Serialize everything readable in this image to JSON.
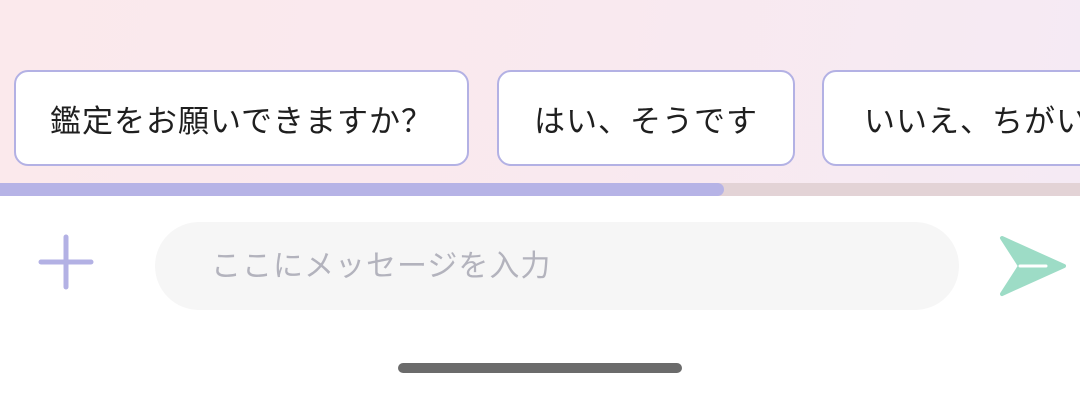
{
  "quick_replies": [
    {
      "label": "鑑定をお願いできますか？"
    },
    {
      "label": "はい、そうです"
    },
    {
      "label": "いいえ、ちがいます"
    }
  ],
  "quick_replies_scroll": {
    "visible_fraction": 0.67
  },
  "composer": {
    "placeholder": "ここにメッセージを入力",
    "value": "",
    "add_icon": "plus-icon",
    "send_icon": "send-arrow-icon"
  },
  "colors": {
    "accent": "#b3b1e4",
    "send": "#9ddcc6",
    "chat_background": "#fbe9ec"
  }
}
